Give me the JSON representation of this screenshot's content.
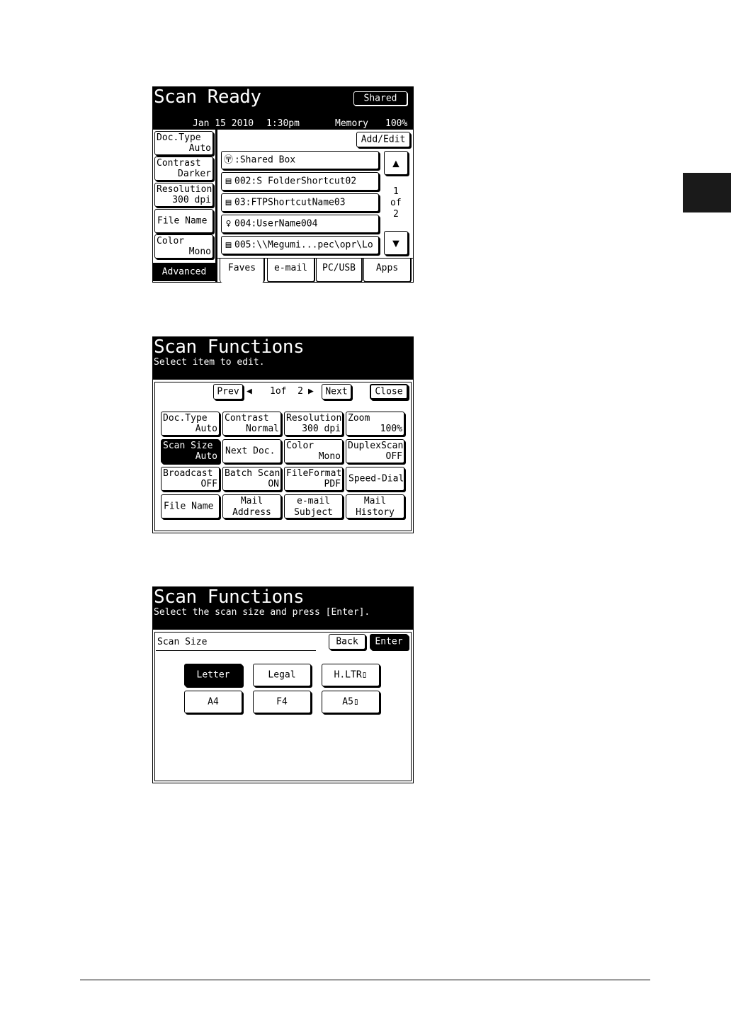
{
  "scan_ready": {
    "title": "Scan Ready",
    "shared_label": "Shared",
    "date": "Jan 15 2010",
    "time": "1:30pm",
    "memory_label": "Memory",
    "memory_value": "100%",
    "left_settings": [
      {
        "label": "Doc.Type",
        "value": "Auto"
      },
      {
        "label": "Contrast",
        "value": "Darker"
      },
      {
        "label": "Resolution",
        "value": "300 dpi"
      },
      {
        "label": "File Name",
        "value": ""
      },
      {
        "label": "Color",
        "value": "Mono"
      }
    ],
    "advanced_label": "Advanced",
    "add_edit_label": "Add/Edit",
    "list": [
      {
        "icon": "shared-box-icon",
        "glyph": "〶",
        "text": ":Shared Box"
      },
      {
        "icon": "folder-shortcut-icon",
        "glyph": "▤",
        "text": "002:S FolderShortcut02"
      },
      {
        "icon": "ftp-shortcut-icon",
        "glyph": "▤",
        "text": "03:FTPShortcutName03"
      },
      {
        "icon": "user-icon",
        "glyph": "♀",
        "text": "004:UserName004"
      },
      {
        "icon": "folder-shortcut-icon",
        "glyph": "▤",
        "text": "005:\\\\Megumi...pec\\opr\\Lo"
      }
    ],
    "page_current": "1",
    "page_of": "of",
    "page_total": "2",
    "up_arrow": "▲",
    "down_arrow": "▼",
    "tabs": [
      "Faves",
      "e-mail",
      "PC/USB",
      "Apps"
    ]
  },
  "scan_functions_1": {
    "title": "Scan Functions",
    "subtitle": "Select item to edit.",
    "prev_label": "Prev",
    "prev_arrow": "◀",
    "page_text": "1of  2",
    "next_arrow": "▶",
    "next_label": "Next",
    "close_label": "Close",
    "grid": [
      {
        "label": "Doc.Type",
        "value": "Auto",
        "layout": "two"
      },
      {
        "label": "Contrast",
        "value": "Normal",
        "layout": "two"
      },
      {
        "label": "Resolution",
        "value": "300 dpi",
        "layout": "two"
      },
      {
        "label": "Zoom",
        "value": "100%",
        "layout": "two"
      },
      {
        "label": "Scan Size",
        "value": "Auto",
        "layout": "two",
        "selected": true
      },
      {
        "label": "Next Doc.",
        "value": "",
        "layout": "one"
      },
      {
        "label": "Color",
        "value": "Mono",
        "layout": "two"
      },
      {
        "label": "DuplexScan",
        "value": "OFF",
        "layout": "two"
      },
      {
        "label": "Broadcast",
        "value": "OFF",
        "layout": "two"
      },
      {
        "label": "Batch Scan",
        "value": "ON",
        "layout": "two"
      },
      {
        "label": "FileFormat",
        "value": "PDF",
        "layout": "two"
      },
      {
        "label": "Speed-Dial",
        "value": "",
        "layout": "one"
      },
      {
        "label": "File Name",
        "value": "",
        "layout": "one"
      },
      {
        "label": "Mail",
        "value": "Address",
        "layout": "center"
      },
      {
        "label": "e-mail",
        "value": "Subject",
        "layout": "center"
      },
      {
        "label": "Mail",
        "value": "History",
        "layout": "center"
      }
    ]
  },
  "scan_functions_2": {
    "title": "Scan Functions",
    "subtitle": "Select the scan size and press [Enter].",
    "field_label": "Scan Size",
    "back_label": "Back",
    "enter_label": "Enter",
    "sizes": [
      {
        "label": "Letter",
        "selected": true
      },
      {
        "label": "Legal",
        "selected": false
      },
      {
        "label": "H.LTR▯",
        "selected": false
      },
      {
        "label": "A4",
        "selected": false
      },
      {
        "label": "F4",
        "selected": false
      },
      {
        "label": "A5▯",
        "selected": false
      }
    ]
  }
}
